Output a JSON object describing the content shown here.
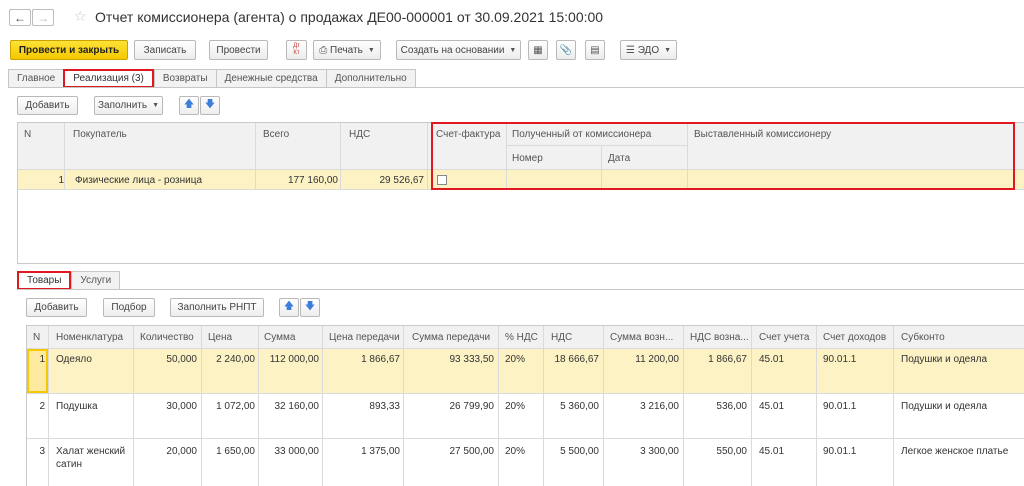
{
  "window": {
    "title": "Отчет комиссионера (агента) о продажах ДЕ00-000001 от 30.09.2021 15:00:00"
  },
  "toolbar": {
    "post_close": "Провести и закрыть",
    "save": "Записать",
    "post": "Провести",
    "dtkt": "Дт Кт",
    "print": "Печать",
    "create_based": "Создать на основании",
    "edo": "ЭДО"
  },
  "tabs": [
    {
      "label": "Главное"
    },
    {
      "label": "Реализация (3)"
    },
    {
      "label": "Возвраты"
    },
    {
      "label": "Денежные средства"
    },
    {
      "label": "Дополнительно"
    }
  ],
  "sales": {
    "add": "Добавить",
    "fill": "Заполнить",
    "headers": {
      "n": "N",
      "buyer": "Покупатель",
      "total": "Всего",
      "vat": "НДС",
      "invoice": "Счет-фактура",
      "received": "Полученный от комиссионера",
      "number": "Номер",
      "date": "Дата",
      "issued": "Выставленный комиссионеру"
    },
    "rows": [
      {
        "n": "1",
        "buyer": "Физические лица - розница",
        "total": "177 160,00",
        "vat": "29 526,67"
      }
    ]
  },
  "subtabs": [
    {
      "label": "Товары"
    },
    {
      "label": "Услуги"
    }
  ],
  "goods": {
    "add": "Добавить",
    "select": "Подбор",
    "fill_rnpt": "Заполнить РНПТ",
    "headers": {
      "n": "N",
      "item": "Номенклатура",
      "qty": "Количество",
      "price": "Цена",
      "sum": "Сумма",
      "transfer_price": "Цена передачи",
      "transfer_sum": "Сумма передачи",
      "vat_rate": "% НДС",
      "vat": "НДС",
      "reward_sum": "Сумма возн...",
      "reward_vat": "НДС возна...",
      "account": "Счет учета",
      "income_account": "Счет доходов",
      "subconto": "Субконто"
    },
    "rows": [
      {
        "n": "1",
        "item": "Одеяло",
        "item2": "",
        "qty": "50,000",
        "price": "2 240,00",
        "sum": "112 000,00",
        "transfer_price": "1 866,67",
        "transfer_sum": "93 333,50",
        "vat_rate": "20%",
        "vat": "18 666,67",
        "reward_sum": "11 200,00",
        "reward_vat": "1 866,67",
        "account": "45.01",
        "income_account": "90.01.1",
        "subconto": "Подушки и одеяла"
      },
      {
        "n": "2",
        "item": "Подушка",
        "item2": "",
        "qty": "30,000",
        "price": "1 072,00",
        "sum": "32 160,00",
        "transfer_price": "893,33",
        "transfer_sum": "26 799,90",
        "vat_rate": "20%",
        "vat": "5 360,00",
        "reward_sum": "3 216,00",
        "reward_vat": "536,00",
        "account": "45.01",
        "income_account": "90.01.1",
        "subconto": "Подушки и одеяла"
      },
      {
        "n": "3",
        "item": "Халат женский",
        "item2": "сатин",
        "qty": "20,000",
        "price": "1 650,00",
        "sum": "33 000,00",
        "transfer_price": "1 375,00",
        "transfer_sum": "27 500,00",
        "vat_rate": "20%",
        "vat": "5 500,00",
        "reward_sum": "3 300,00",
        "reward_vat": "550,00",
        "account": "45.01",
        "income_account": "90.01.1",
        "subconto": "Легкое женское платье"
      }
    ]
  },
  "colors": {
    "accent_yellow": "#f5c800",
    "selected_row": "#fcf2c4",
    "highlight_red": "#e0181f",
    "arrow_blue": "#3d7fd8"
  }
}
